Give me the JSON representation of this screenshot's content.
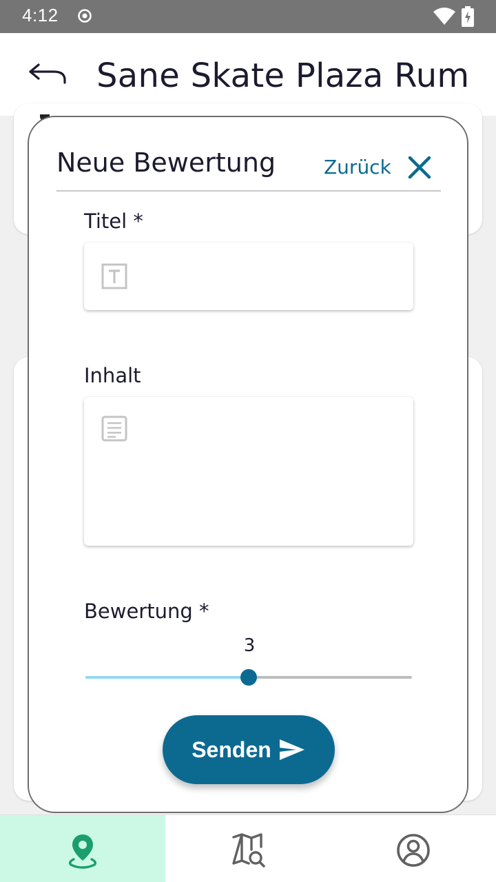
{
  "status_bar": {
    "time": "4:12",
    "icons": [
      "record-icon",
      "wifi-icon",
      "battery-charging-icon"
    ]
  },
  "header": {
    "title": "Sane Skate Plaza Rum",
    "back_icon": "back-arrow-icon"
  },
  "dialog": {
    "title": "Neue Bewertung",
    "back_label": "Zurück",
    "close_icon": "close-icon",
    "fields": {
      "title": {
        "label": "Titel *",
        "value": "",
        "placeholder": "",
        "icon": "text-field-icon"
      },
      "content": {
        "label": "Inhalt",
        "value": "",
        "placeholder": "",
        "icon": "notes-icon"
      },
      "rating": {
        "label": "Bewertung *",
        "value": "3",
        "min": 1,
        "max": 5
      }
    },
    "submit_label": "Senden",
    "submit_icon": "send-icon"
  },
  "bottom_nav": {
    "items": [
      {
        "name": "spots",
        "icon": "location-pin-icon",
        "active": true
      },
      {
        "name": "map",
        "icon": "map-search-icon",
        "active": false
      },
      {
        "name": "profile",
        "icon": "account-circle-icon",
        "active": false
      }
    ]
  },
  "colors": {
    "primary": "#0c6a91",
    "slider_fill": "#93d8f3",
    "nav_active_bg": "#ccf9e6",
    "nav_active_icon": "#1a9e6e",
    "text": "#1c1b2e",
    "status_bar": "#757575"
  }
}
